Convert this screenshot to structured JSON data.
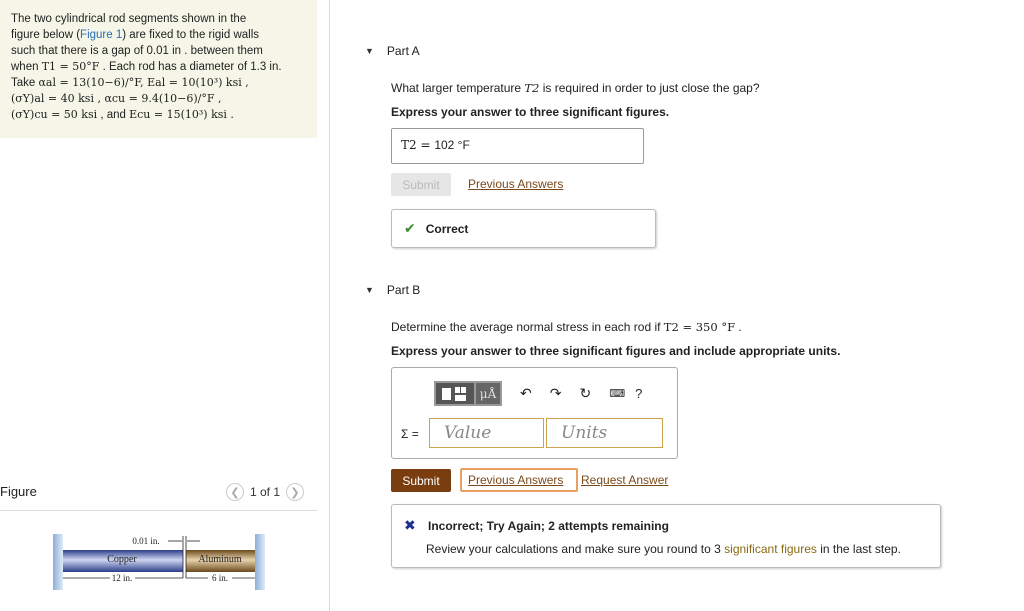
{
  "problem": {
    "line1": "The two cylindrical rod segments shown in the",
    "line2a": "figure below (",
    "figure_link": "Figure 1",
    "line2b": ") are fixed to the rigid walls",
    "line3": "such that there is a gap of 0.01 in . between them",
    "line4a": "when ",
    "line4_math": "T1 = 50°F",
    "line4b": " . Each rod has a diameter of 1.3 in.",
    "line5a": "Take ",
    "line5_math": "αal = 13(10−6)/°F, Eal = 10(10³) ksi ,",
    "line6_math": "(σY)al = 40 ksi , αcu = 9.4(10−6)/°F ,",
    "line7_math": "(σY)cu = 50 ksi",
    "line7b": " , and ",
    "line7_math2": "Ecu = 15(10³) ksi ."
  },
  "figure_panel": {
    "title": "Figure",
    "pager": "1 of 1",
    "prev_icon": "chevron-left-icon",
    "next_icon": "chevron-right-icon",
    "gap_label": "0.01 in.",
    "copper_label": "Copper",
    "aluminum_label": "Aluminum",
    "copper_length": "12 in.",
    "aluminum_length": "6 in."
  },
  "partA": {
    "title": "Part A",
    "question_a": "What larger temperature ",
    "question_math": "T2",
    "question_b": " is required in order to just close the gap?",
    "instruction": "Express your answer to three significant figures.",
    "answer_lhs": "T2 = ",
    "answer_value": "102 °F",
    "submit_label": "Submit",
    "prev_answers": "Previous Answers",
    "feedback": "Correct"
  },
  "partB": {
    "title": "Part B",
    "question_a": "Determine the average normal stress in each rod if ",
    "question_math": "T2 = 350 °F",
    "question_b": " .",
    "instruction": "Express your answer to three significant figures and include appropriate units.",
    "toolbar_mu": "μÅ",
    "toolbar_help": "?",
    "sigma_label": "Σ =",
    "value_placeholder": "Value",
    "units_placeholder": "Units",
    "submit_label": "Submit",
    "prev_answers": "Previous Answers",
    "request_answer": "Request Answer",
    "feedback_title": "Incorrect; Try Again; 2 attempts remaining",
    "feedback_a": "Review your calculations and make sure you round to 3 ",
    "feedback_hl": "significant figures",
    "feedback_b": " in the last step."
  },
  "colors": {
    "accent": "#7a3d10",
    "correct": "#3b8a2f",
    "incorrect": "#1b2f8f",
    "link": "#2a6db5"
  }
}
